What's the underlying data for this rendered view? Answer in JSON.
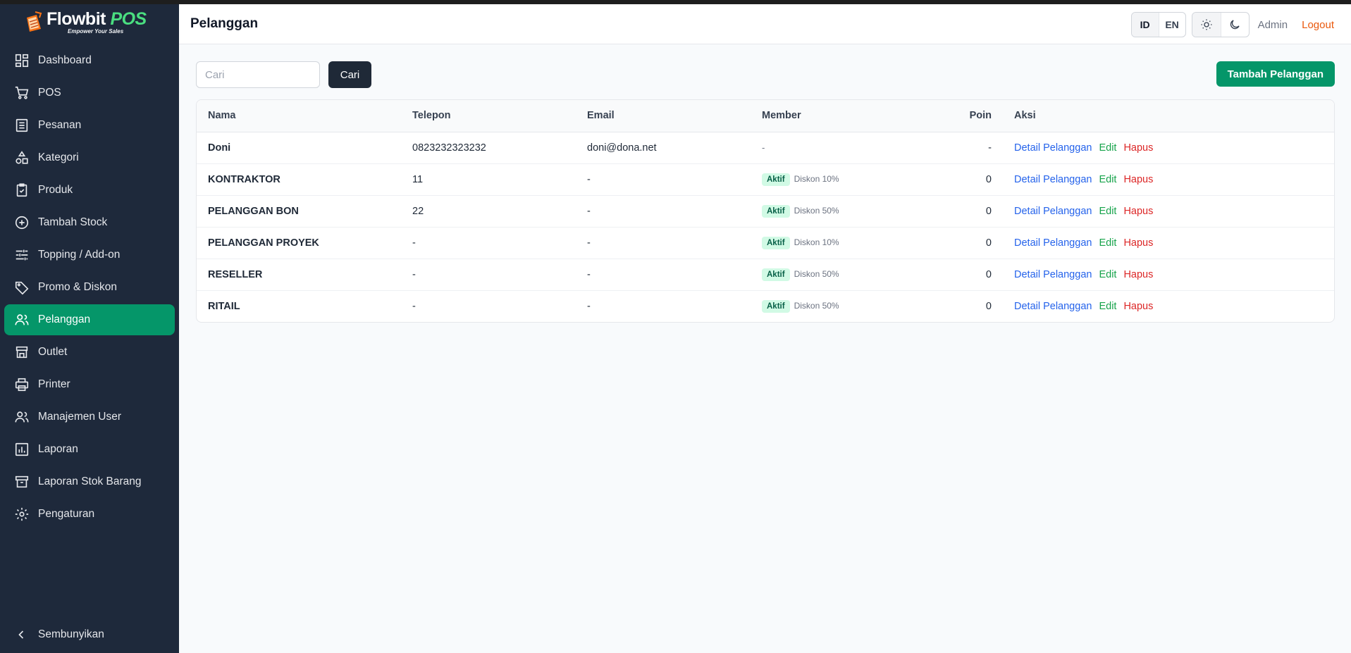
{
  "brand": {
    "name": "Flowbit",
    "suffix": "POS",
    "tagline": "Empower Your Sales"
  },
  "sidebar": {
    "items": [
      {
        "label": "Dashboard",
        "icon": "dashboard-icon"
      },
      {
        "label": "POS",
        "icon": "cart-icon"
      },
      {
        "label": "Pesanan",
        "icon": "receipt-icon"
      },
      {
        "label": "Kategori",
        "icon": "shapes-icon"
      },
      {
        "label": "Produk",
        "icon": "clipboard-check-icon"
      },
      {
        "label": "Tambah Stock",
        "icon": "plus-circle-icon"
      },
      {
        "label": "Topping / Add-on",
        "icon": "sliders-icon"
      },
      {
        "label": "Promo & Diskon",
        "icon": "tag-icon"
      },
      {
        "label": "Pelanggan",
        "icon": "users-icon",
        "active": true
      },
      {
        "label": "Outlet",
        "icon": "store-icon"
      },
      {
        "label": "Printer",
        "icon": "printer-icon"
      },
      {
        "label": "Manajemen User",
        "icon": "user-group-icon"
      },
      {
        "label": "Laporan",
        "icon": "bar-chart-icon"
      },
      {
        "label": "Laporan Stok Barang",
        "icon": "archive-icon"
      },
      {
        "label": "Pengaturan",
        "icon": "gear-icon"
      }
    ],
    "collapse_label": "Sembunyikan"
  },
  "header": {
    "title": "Pelanggan",
    "lang_id": "ID",
    "lang_en": "EN",
    "user": "Admin",
    "logout": "Logout"
  },
  "toolbar": {
    "search_placeholder": "Cari",
    "search_button": "Cari",
    "add_button": "Tambah Pelanggan"
  },
  "table": {
    "columns": [
      "Nama",
      "Telepon",
      "Email",
      "Member",
      "Poin",
      "Aksi"
    ],
    "rows": [
      {
        "nama": "Doni",
        "telepon": "0823232323232",
        "email": "doni@dona.net",
        "member_status": "-",
        "member_discount": "",
        "poin": "-"
      },
      {
        "nama": "KONTRAKTOR",
        "telepon": "11",
        "email": "-",
        "member_status": "Aktif",
        "member_discount": "Diskon 10%",
        "poin": "0"
      },
      {
        "nama": "PELANGGAN BON",
        "telepon": "22",
        "email": "-",
        "member_status": "Aktif",
        "member_discount": "Diskon 50%",
        "poin": "0"
      },
      {
        "nama": "PELANGGAN PROYEK",
        "telepon": "-",
        "email": "-",
        "member_status": "Aktif",
        "member_discount": "Diskon 10%",
        "poin": "0"
      },
      {
        "nama": "RESELLER",
        "telepon": "-",
        "email": "-",
        "member_status": "Aktif",
        "member_discount": "Diskon 50%",
        "poin": "0"
      },
      {
        "nama": "RITAIL",
        "telepon": "-",
        "email": "-",
        "member_status": "Aktif",
        "member_discount": "Diskon 50%",
        "poin": "0"
      }
    ],
    "actions": {
      "detail": "Detail Pelanggan",
      "edit": "Edit",
      "hapus": "Hapus"
    }
  },
  "colors": {
    "accent": "#059669",
    "sidebar": "#1e293b",
    "logout": "#ea580c"
  }
}
